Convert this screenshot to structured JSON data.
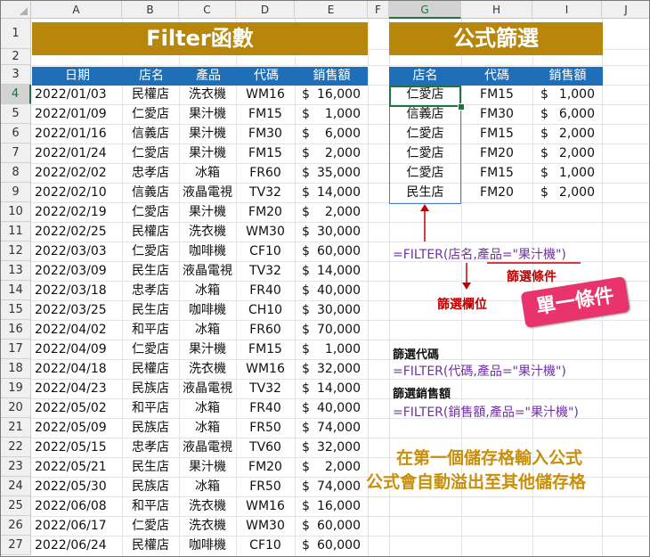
{
  "columns": [
    "A",
    "B",
    "C",
    "D",
    "E",
    "F",
    "G",
    "H",
    "I",
    "J"
  ],
  "rows": [
    "1",
    "2",
    "3",
    "4",
    "5",
    "6",
    "7",
    "8",
    "9",
    "10",
    "11",
    "12",
    "13",
    "14",
    "15",
    "16",
    "17",
    "18",
    "19",
    "20",
    "21",
    "22",
    "23",
    "24",
    "25",
    "26",
    "27"
  ],
  "left_title": "Filter函數",
  "right_title": "公式篩選",
  "left_headers": [
    "日期",
    "店名",
    "產品",
    "代碼",
    "銷售額"
  ],
  "right_headers": [
    "店名",
    "代碼",
    "銷售額"
  ],
  "left_table": [
    [
      "2022/01/03",
      "民權店",
      "洗衣機",
      "WM16",
      "$",
      "16,000"
    ],
    [
      "2022/01/09",
      "仁愛店",
      "果汁機",
      "FM15",
      "$",
      "1,000"
    ],
    [
      "2022/01/16",
      "信義店",
      "果汁機",
      "FM30",
      "$",
      "6,000"
    ],
    [
      "2022/01/24",
      "仁愛店",
      "果汁機",
      "FM15",
      "$",
      "2,000"
    ],
    [
      "2022/02/02",
      "忠孝店",
      "冰箱",
      "FR60",
      "$",
      "35,000"
    ],
    [
      "2022/02/10",
      "信義店",
      "液晶電視",
      "TV32",
      "$",
      "14,000"
    ],
    [
      "2022/02/19",
      "仁愛店",
      "果汁機",
      "FM20",
      "$",
      "2,000"
    ],
    [
      "2022/02/25",
      "民權店",
      "洗衣機",
      "WM30",
      "$",
      "30,000"
    ],
    [
      "2022/03/03",
      "仁愛店",
      "咖啡機",
      "CF10",
      "$",
      "60,000"
    ],
    [
      "2022/03/09",
      "民生店",
      "液晶電視",
      "TV32",
      "$",
      "14,000"
    ],
    [
      "2022/03/18",
      "忠孝店",
      "冰箱",
      "FR40",
      "$",
      "40,000"
    ],
    [
      "2022/03/25",
      "民生店",
      "咖啡機",
      "CH10",
      "$",
      "30,000"
    ],
    [
      "2022/04/02",
      "和平店",
      "冰箱",
      "FR60",
      "$",
      "70,000"
    ],
    [
      "2022/04/09",
      "仁愛店",
      "果汁機",
      "FM15",
      "$",
      "1,000"
    ],
    [
      "2022/04/18",
      "民權店",
      "洗衣機",
      "WM16",
      "$",
      "32,000"
    ],
    [
      "2022/04/23",
      "民族店",
      "液晶電視",
      "TV32",
      "$",
      "14,000"
    ],
    [
      "2022/05/02",
      "和平店",
      "冰箱",
      "FR40",
      "$",
      "40,000"
    ],
    [
      "2022/05/09",
      "民族店",
      "冰箱",
      "FR50",
      "$",
      "74,000"
    ],
    [
      "2022/05/15",
      "忠孝店",
      "液晶電視",
      "TV60",
      "$",
      "32,000"
    ],
    [
      "2022/05/21",
      "民生店",
      "果汁機",
      "FM20",
      "$",
      "2,000"
    ],
    [
      "2022/05/30",
      "民族店",
      "冰箱",
      "FR50",
      "$",
      "74,000"
    ],
    [
      "2022/06/08",
      "和平店",
      "洗衣機",
      "WM16",
      "$",
      "16,000"
    ],
    [
      "2022/06/17",
      "仁愛店",
      "洗衣機",
      "WM30",
      "$",
      "60,000"
    ],
    [
      "2022/06/24",
      "民權店",
      "咖啡機",
      "CF10",
      "$",
      "60,000"
    ]
  ],
  "right_table": [
    [
      "仁愛店",
      "FM15",
      "$",
      "1,000"
    ],
    [
      "信義店",
      "FM30",
      "$",
      "6,000"
    ],
    [
      "仁愛店",
      "FM15",
      "$",
      "2,000"
    ],
    [
      "仁愛店",
      "FM20",
      "$",
      "2,000"
    ],
    [
      "仁愛店",
      "FM15",
      "$",
      "1,000"
    ],
    [
      "民生店",
      "FM20",
      "$",
      "2,000"
    ]
  ],
  "formula_main": "=FILTER(店名,產品=\"果汁機\")",
  "label_condition": "篩選條件",
  "label_field": "篩選欄位",
  "tag_single": "單一條件",
  "label_code": "篩選代碼",
  "formula_code": "=FILTER(代碼,產品=\"果汁機\")",
  "label_sales": "篩選銷售額",
  "formula_sales": "=FILTER(銷售額,產品=\"果汁機\")",
  "note_line1": "在第一個儲存格輸入公式",
  "note_line2": "公式會自動溢出至其他儲存格",
  "colors": {
    "banner": "#b8860b",
    "header": "#1f6fb8",
    "formula": "#7030a0",
    "accent": "#c00000",
    "tag": "#e8336d",
    "note": "#c8900a"
  }
}
